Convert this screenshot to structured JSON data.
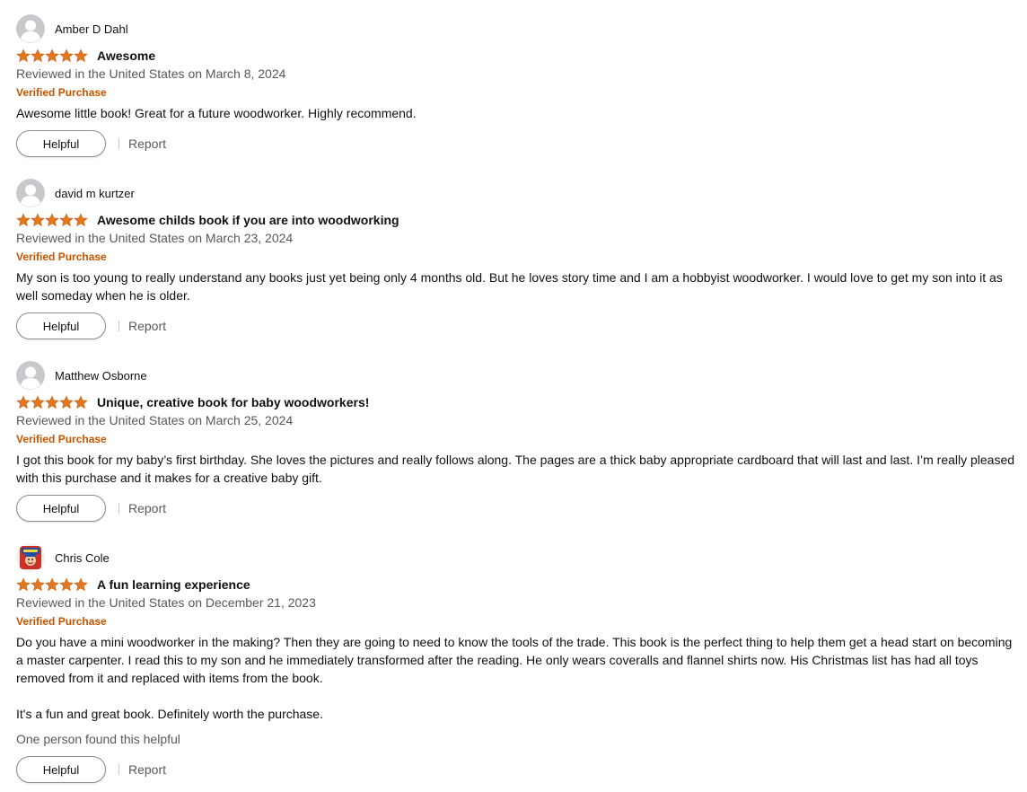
{
  "colors": {
    "star": "#de7921",
    "verified": "#c45500",
    "secondary_text": "#565959"
  },
  "reviews": [
    {
      "reviewer": "Amber D Dahl",
      "avatar": "default-avatar-icon",
      "stars": 5,
      "title": "Awesome",
      "date": "Reviewed in the United States on March 8, 2024",
      "verified": "Verified Purchase",
      "body": [
        "Awesome little book! Great for a future woodworker. Highly recommend."
      ],
      "helpful_count": "",
      "helpful_label": "Helpful",
      "report_label": "Report"
    },
    {
      "reviewer": "david m kurtzer",
      "avatar": "default-avatar-icon",
      "stars": 5,
      "title": "Awesome childs book if you are into woodworking",
      "date": "Reviewed in the United States on March 23, 2024",
      "verified": "Verified Purchase",
      "body": [
        "My son is too young to really understand any books just yet being only 4 months old. But he loves story time and I am a hobbyist woodworker. I would love to get my son into it as well someday when he is older."
      ],
      "helpful_count": "",
      "helpful_label": "Helpful",
      "report_label": "Report"
    },
    {
      "reviewer": "Matthew Osborne",
      "avatar": "default-avatar-icon",
      "stars": 5,
      "title": "Unique, creative book for baby woodworkers!",
      "date": "Reviewed in the United States on March 25, 2024",
      "verified": "Verified Purchase",
      "body": [
        "I got this book for my baby’s first birthday. She loves the pictures and really follows along. The pages are a thick baby appropriate cardboard that will last and last. I’m really pleased with this purchase and it makes for a creative baby gift."
      ],
      "helpful_count": "",
      "helpful_label": "Helpful",
      "report_label": "Report"
    },
    {
      "reviewer": "Chris Cole",
      "avatar": "cereal-box-avatar-icon",
      "stars": 5,
      "title": "A fun learning experience",
      "date": "Reviewed in the United States on December 21, 2023",
      "verified": "Verified Purchase",
      "body": [
        "Do you have a mini woodworker in the making? Then they are going to need to know the tools of the trade. This book is the perfect thing to help them get a head start on becoming a master carpenter. I read this to my son and he immediately transformed after the reading. He only wears coveralls and flannel shirts now. His Christmas list has had all toys removed from it and replaced with items from the book.",
        "It's a fun and great book. Definitely worth the purchase."
      ],
      "helpful_count": "One person found this helpful",
      "helpful_label": "Helpful",
      "report_label": "Report"
    }
  ]
}
